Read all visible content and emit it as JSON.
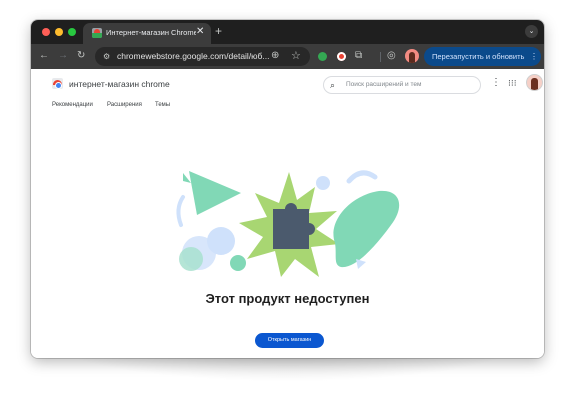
{
  "browser": {
    "tab": {
      "title": "Интернет-магазин Chrome",
      "close_glyph": "✕"
    },
    "new_tab_glyph": "+",
    "tab_menu_glyph": "⌄",
    "nav": {
      "back_glyph": "←",
      "forward_glyph": "→",
      "reload_glyph": "↻"
    },
    "omnibox": {
      "url": "chromewebstore.google.com/detail/юб...",
      "tune_glyph": "⚙",
      "zoom_glyph": "⊕",
      "star_glyph": "☆"
    },
    "extensions": [
      {
        "name": "extension-1",
        "color": "#34a853"
      },
      {
        "name": "extension-2",
        "color": "#ea4335"
      }
    ],
    "puzzle_glyph": "⧉",
    "sync_glyph": "◎",
    "relaunch_button": {
      "label": "Перезапустить и обновить",
      "menu_glyph": "⋮"
    }
  },
  "store": {
    "name": "интернет-магазин chrome",
    "search_placeholder": "Поиск расширений и тем",
    "search_glyph": "⌕",
    "menu_glyph": "⋮",
    "apps_glyph": "⋮⋮⋮",
    "nav": [
      "Рекомендации",
      "Расширения",
      "Темы"
    ]
  },
  "main": {
    "headline": "Этот продукт недоступен",
    "open_store_button": "Открыть магазин"
  },
  "colors": {
    "accent": "#0b57d0",
    "relaunch_bg": "#0b4a8b",
    "illustration_green": "#a8d672",
    "illustration_mint": "#81d8b6",
    "illustration_blue": "#cfe1fb",
    "puzzle": "#4b5a6d"
  }
}
